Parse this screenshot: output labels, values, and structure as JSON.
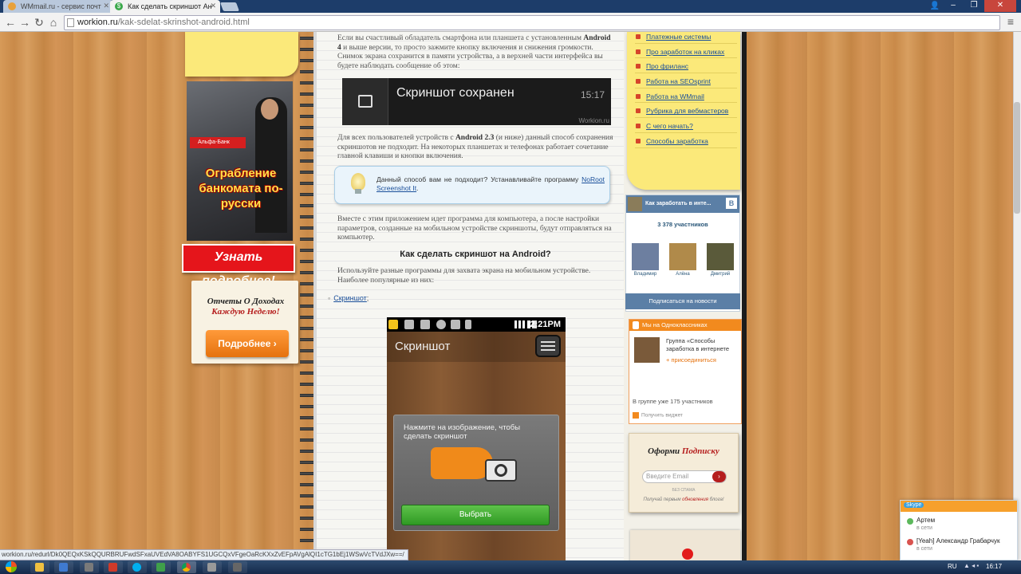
{
  "browser": {
    "tabs": [
      {
        "title": "WMmail.ru - сервис почт",
        "active": false
      },
      {
        "title": "Как сделать скриншот Ан",
        "active": true
      }
    ],
    "url_host": "workion.ru",
    "url_path": "/kak-sdelat-skrinshot-android.html",
    "status_url": "workion.ru/redurl/Dk0QEQxKSkQQURBRUFwdSFxaUVEdVA8OABYFS1UGCQxVFgeOaRcKXxZvEFpAVgAlQI1cTG1bEj1WSwVcTVdJXw==/"
  },
  "left_ads": {
    "atm_ad": {
      "bank": "Альфа-Банк",
      "headline": "Ограбление банкомата по-русски"
    },
    "learn_more": "Узнать подробнее!",
    "income_card": {
      "title_line1": "Отчеты О Доходах",
      "title_line2": "Каждую Неделю!",
      "button": "Подробнее"
    }
  },
  "article": {
    "p1_pre": "Если вы счастливый обладатель смартфона или планшета с установленным ",
    "p1_bold": "Android 4",
    "p1_post": " и выше версии, то просто зажмите кнопку включения и снижения громкости. Снимок экрана сохранится в памяти устройства, а в верхней части интерфейса вы будете наблюдать сообщение об этом:",
    "toast": {
      "message": "Скриншот сохранен",
      "time": "15:17",
      "watermark": "Workion.ru"
    },
    "p2_pre": "Для всех пользователей устройств с ",
    "p2_bold": "Android 2.3",
    "p2_post": " (и ниже) данный способ сохранения скриншотов не подходит. На некоторых планшетах и телефонах работает сочетание главной клавиши и кнопки включения.",
    "tip": {
      "text": "Данный способ вам не подходит? Устанавливайте программу ",
      "link": "NoRoot Screenshot It",
      "end": "."
    },
    "p3": "Вместе с этим приложением идет программа для компьютера, а после настройки параметров, созданные на мобильном устройстве скриншоты, будут отправляться на компьютер.",
    "heading": "Как сделать скриншот на Android?",
    "p4": "Используйте разные программы для захвата экрана на мобильном устройстве. Наиболее популярные из них:",
    "bullet_link": "Скриншот",
    "bullet_sep": ";",
    "phone": {
      "clock": "2:21PM",
      "app_title": "Скриншот",
      "dialog_text": "Нажмите на изображение, чтобы сделать скриншот",
      "select_button": "Выбрать"
    }
  },
  "sidebar": {
    "categories": [
      "Платежные системы",
      "Про заработок на кликах",
      "Про фриланс",
      "Работа на SEOsprint",
      "Работа на WMmail",
      "Рубрика для вебмастеров",
      "С чего начать?",
      "Способы заработка"
    ],
    "vk": {
      "title": "Как заработать в инте...",
      "badge": "В",
      "count": "3 378 участников",
      "members": [
        "Владимир",
        "Алёна",
        "Дмитрий"
      ],
      "subscribe": "Подписаться на новости"
    },
    "ok": {
      "header": "Мы на Одноклассниках",
      "group_title": "Группа «Способы заработка в интернете",
      "join": "+ присоединиться",
      "members": "В группе уже 175 участников",
      "footer": "Получить виджет"
    },
    "subscribe_card": {
      "title_pre": "Оформи ",
      "title_accent": "Подписку",
      "placeholder": "Введите Email",
      "go": "›",
      "nospam": "БЕЗ СПАМА",
      "note_pre": "Получай первым ",
      "note_accent": "обновления",
      "note_post": " блога!"
    }
  },
  "skype": {
    "brand": "Skype",
    "contacts": [
      {
        "name": "Артем",
        "status": "в сети",
        "color": "#5cb85c"
      },
      {
        "name": "[Yeah] Александр Грабарчук",
        "status": "в сети",
        "color": "#d9534f"
      }
    ]
  },
  "taskbar": {
    "lang": "RU",
    "time": "16:17"
  }
}
